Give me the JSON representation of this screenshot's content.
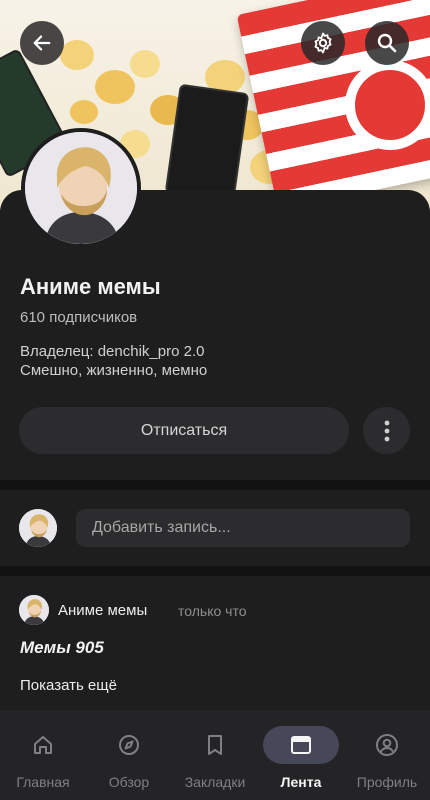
{
  "header": {
    "back_icon": "arrow-left-icon",
    "settings_icon": "gear-icon",
    "search_icon": "search-icon"
  },
  "community": {
    "name": "Аниме мемы",
    "subscribers": "610 подписчиков",
    "owner_line": "Владелец: denchik_pro 2.0",
    "description": "Смешно, жизненно, мемно",
    "unsubscribe_label": "Отписаться",
    "more_icon": "more-vertical-icon"
  },
  "composer": {
    "placeholder": "Добавить запись..."
  },
  "post": {
    "author": "Аниме мемы",
    "time": "только что",
    "title": "Мемы 905",
    "show_more": "Показать ещё"
  },
  "nav": {
    "items": [
      {
        "label": "Главная",
        "icon": "home-icon"
      },
      {
        "label": "Обзор",
        "icon": "compass-icon"
      },
      {
        "label": "Закладки",
        "icon": "bookmark-icon"
      },
      {
        "label": "Лента",
        "icon": "feed-icon",
        "active": true
      },
      {
        "label": "Профиль",
        "icon": "profile-icon"
      }
    ]
  },
  "colors": {
    "background": "#121212",
    "surface": "#1e1e1f",
    "button": "#2c2c2e",
    "nav_active_pill": "#47475a",
    "cover_red": "#e53935"
  }
}
